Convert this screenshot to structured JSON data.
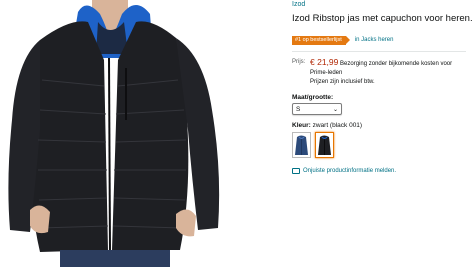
{
  "product": {
    "brand": "Izod",
    "title": "Izod Ribstop jas met capuchon voor heren.",
    "badge": "#1 op bestsellerlijst",
    "category_link": "in Jacks heren"
  },
  "price": {
    "label": "Prijs:",
    "value": "€ 21,99",
    "shipping": "Bezorging zonder bijkomende kosten voor",
    "shipping_2": "Prime-leden",
    "vat_note": "Prijzen zijn inclusief btw."
  },
  "size": {
    "label": "Maat/grootte:",
    "selected": "S"
  },
  "color": {
    "label": "Kleur:",
    "value": "zwart (black 001)"
  },
  "report": {
    "label": "Onjuiste productinformatie melden."
  },
  "colors": {
    "link": "#007185",
    "price": "#b12704",
    "badge": "#e47911",
    "jacket": "#1e1f23",
    "lining": "#1e62c8"
  }
}
